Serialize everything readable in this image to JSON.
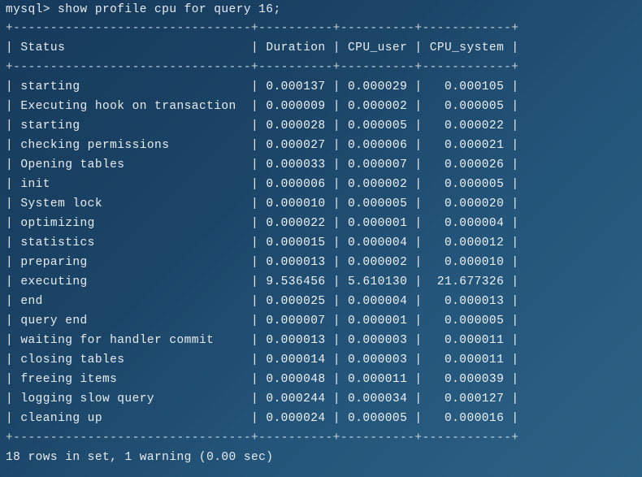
{
  "terminal": {
    "command_line": "mysql> show profile cpu for query 16;",
    "footer": "18 rows in set, 1 warning (0.00 sec)",
    "separator_line": "+--------------------------------+----------+----------+------------+",
    "headers": [
      "Status",
      "Duration",
      "CPU_user",
      "CPU_system"
    ],
    "rows": [
      [
        "starting",
        "0.000137",
        "0.000029",
        "0.000105"
      ],
      [
        "Executing hook on transaction",
        "0.000009",
        "0.000002",
        "0.000005"
      ],
      [
        "starting",
        "0.000028",
        "0.000005",
        "0.000022"
      ],
      [
        "checking permissions",
        "0.000027",
        "0.000006",
        "0.000021"
      ],
      [
        "Opening tables",
        "0.000033",
        "0.000007",
        "0.000026"
      ],
      [
        "init",
        "0.000006",
        "0.000002",
        "0.000005"
      ],
      [
        "System lock",
        "0.000010",
        "0.000005",
        "0.000020"
      ],
      [
        "optimizing",
        "0.000022",
        "0.000001",
        "0.000004"
      ],
      [
        "statistics",
        "0.000015",
        "0.000004",
        "0.000012"
      ],
      [
        "preparing",
        "0.000013",
        "0.000002",
        "0.000010"
      ],
      [
        "executing",
        "9.536456",
        "5.610130",
        "21.677326"
      ],
      [
        "end",
        "0.000025",
        "0.000004",
        "0.000013"
      ],
      [
        "query end",
        "0.000007",
        "0.000001",
        "0.000005"
      ],
      [
        "waiting for handler commit",
        "0.000013",
        "0.000003",
        "0.000011"
      ],
      [
        "closing tables",
        "0.000014",
        "0.000003",
        "0.000011"
      ],
      [
        "freeing items",
        "0.000048",
        "0.000011",
        "0.000039"
      ],
      [
        "logging slow query",
        "0.000244",
        "0.000034",
        "0.000127"
      ],
      [
        "cleaning up",
        "0.000024",
        "0.000005",
        "0.000016"
      ]
    ]
  }
}
